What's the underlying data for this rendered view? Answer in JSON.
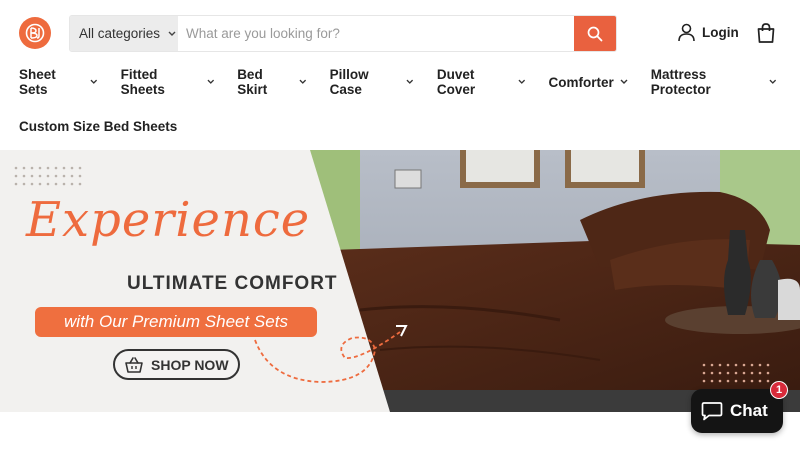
{
  "brand": {
    "logo_icon": "bedsheet-logo-icon",
    "accent": "#ee6b3e"
  },
  "search": {
    "category": "All categories",
    "placeholder": "What are you looking for?",
    "value": ""
  },
  "account": {
    "login_label": "Login"
  },
  "nav": {
    "items": [
      {
        "label": "Sheet Sets"
      },
      {
        "label": "Fitted Sheets"
      },
      {
        "label": "Bed Skirt"
      },
      {
        "label": "Pillow Case"
      },
      {
        "label": "Duvet Cover"
      },
      {
        "label": "Comforter"
      },
      {
        "label": "Mattress Protector"
      }
    ],
    "second_row": "Custom Size Bed Sheets"
  },
  "hero": {
    "script_title": "Experience",
    "headline": "ULTIMATE COMFORT",
    "subline": "with Our Premium Sheet Sets",
    "cta": "SHOP NOW",
    "cta_icon": "shopping-basket-icon"
  },
  "chat": {
    "label": "Chat",
    "badge": "1",
    "icon": "chat-bubble-icon"
  }
}
